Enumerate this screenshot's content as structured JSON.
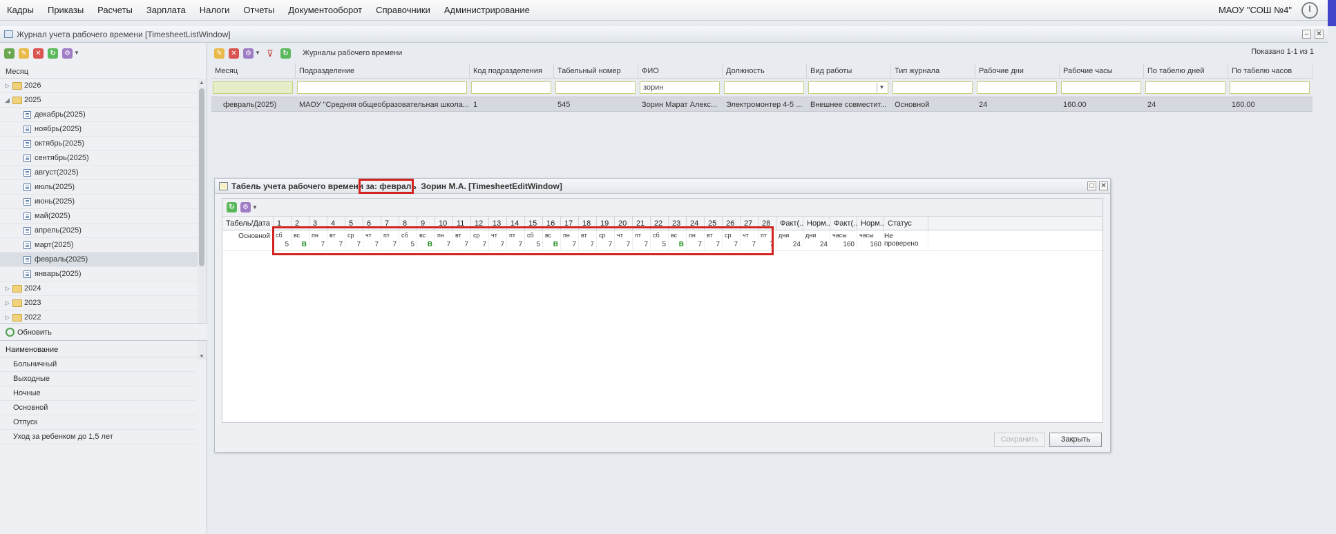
{
  "menu": [
    "Кадры",
    "Приказы",
    "Расчеты",
    "Зарплата",
    "Налоги",
    "Отчеты",
    "Документооборот",
    "Справочники",
    "Администрирование"
  ],
  "organization": "МАОУ \"СОШ №4\"",
  "list_window": {
    "title": "Журнал учета рабочего времени [TimesheetListWindow]",
    "toolbar_title": "Журналы рабочего времени",
    "shown_count": "Показано 1-1 из 1"
  },
  "tree": {
    "header": "Месяц",
    "rows": [
      {
        "label": "2026",
        "type": "year",
        "expanded": false
      },
      {
        "label": "2025",
        "type": "year",
        "expanded": true
      },
      {
        "label": "декабрь(2025)",
        "type": "month"
      },
      {
        "label": "ноябрь(2025)",
        "type": "month"
      },
      {
        "label": "октябрь(2025)",
        "type": "month"
      },
      {
        "label": "сентябрь(2025)",
        "type": "month"
      },
      {
        "label": "август(2025)",
        "type": "month"
      },
      {
        "label": "июль(2025)",
        "type": "month"
      },
      {
        "label": "июнь(2025)",
        "type": "month"
      },
      {
        "label": "май(2025)",
        "type": "month"
      },
      {
        "label": "апрель(2025)",
        "type": "month"
      },
      {
        "label": "март(2025)",
        "type": "month"
      },
      {
        "label": "февраль(2025)",
        "type": "month",
        "selected": true
      },
      {
        "label": "январь(2025)",
        "type": "month"
      },
      {
        "label": "2024",
        "type": "year",
        "expanded": false
      },
      {
        "label": "2023",
        "type": "year",
        "expanded": false
      },
      {
        "label": "2022",
        "type": "year",
        "expanded": false
      }
    ],
    "refresh_label": "Обновить"
  },
  "types": {
    "header": "Наименование",
    "items": [
      "Больничный",
      "Выходные",
      "Ночные",
      "Основной",
      "Отпуск",
      "Уход за ребенком до 1,5 лет"
    ]
  },
  "grid": {
    "columns": [
      "Месяц",
      "Подразделение",
      "Код подразделения",
      "Табельный номер",
      "ФИО",
      "Должность",
      "Вид работы",
      "Тип журнала",
      "Рабочие дни",
      "Рабочие часы",
      "По табелю дней",
      "По табелю часов"
    ],
    "filter_fio": "зорин",
    "row": [
      "февраль(2025)",
      "МАОУ \"Средняя общеобразовательная школа...",
      "1",
      "545",
      "Зорин Марат Алекс...",
      "Электромонтер 4-5 ...",
      "Внешнее совместит...",
      "Основной",
      "24",
      "160.00",
      "24",
      "160.00"
    ]
  },
  "edit_window": {
    "title": "Табель учета рабочего времени за: февраль  Зорин М.А. [TimesheetEditWindow]",
    "head_label": "Табель/Дата",
    "row_label": "Основной",
    "days": [
      {
        "d": "1",
        "wd": "сб",
        "v": "5"
      },
      {
        "d": "2",
        "wd": "вс",
        "v": "В"
      },
      {
        "d": "3",
        "wd": "пн",
        "v": "7"
      },
      {
        "d": "4",
        "wd": "вт",
        "v": "7"
      },
      {
        "d": "5",
        "wd": "ср",
        "v": "7"
      },
      {
        "d": "6",
        "wd": "чт",
        "v": "7"
      },
      {
        "d": "7",
        "wd": "пт",
        "v": "7"
      },
      {
        "d": "8",
        "wd": "сб",
        "v": "5"
      },
      {
        "d": "9",
        "wd": "вс",
        "v": "В"
      },
      {
        "d": "10",
        "wd": "пн",
        "v": "7"
      },
      {
        "d": "11",
        "wd": "вт",
        "v": "7"
      },
      {
        "d": "12",
        "wd": "ср",
        "v": "7"
      },
      {
        "d": "13",
        "wd": "чт",
        "v": "7"
      },
      {
        "d": "14",
        "wd": "пт",
        "v": "7"
      },
      {
        "d": "15",
        "wd": "сб",
        "v": "5"
      },
      {
        "d": "16",
        "wd": "вс",
        "v": "В"
      },
      {
        "d": "17",
        "wd": "пн",
        "v": "7"
      },
      {
        "d": "18",
        "wd": "вт",
        "v": "7"
      },
      {
        "d": "19",
        "wd": "ср",
        "v": "7"
      },
      {
        "d": "20",
        "wd": "чт",
        "v": "7"
      },
      {
        "d": "21",
        "wd": "пт",
        "v": "7"
      },
      {
        "d": "22",
        "wd": "сб",
        "v": "5"
      },
      {
        "d": "23",
        "wd": "вс",
        "v": "В"
      },
      {
        "d": "24",
        "wd": "пн",
        "v": "7"
      },
      {
        "d": "25",
        "wd": "вт",
        "v": "7"
      },
      {
        "d": "26",
        "wd": "ср",
        "v": "7"
      },
      {
        "d": "27",
        "wd": "чт",
        "v": "7"
      },
      {
        "d": "28",
        "wd": "пт",
        "v": "7"
      }
    ],
    "summary_heads": [
      "Факт(...",
      "Норм...",
      "Факт(...",
      "Норм...",
      "Статус"
    ],
    "summary_vals": [
      {
        "unit": "дни",
        "v": "24"
      },
      {
        "unit": "дни",
        "v": "24"
      },
      {
        "unit": "часы",
        "v": "160"
      },
      {
        "unit": "часы",
        "v": "160"
      }
    ],
    "status": "Не проверено",
    "save_label": "Сохранить",
    "close_label": "Закрыть"
  },
  "colors": {
    "highlight": "#d2231e",
    "weekend": "#1a8c1a",
    "accent": "#3f44c9"
  }
}
